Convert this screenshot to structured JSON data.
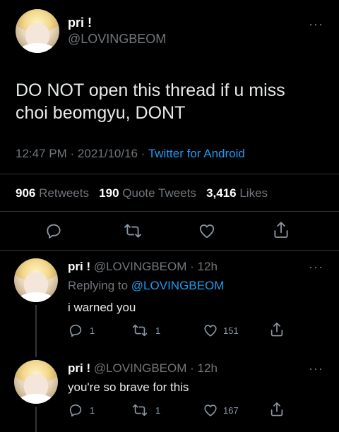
{
  "main_tweet": {
    "display_name": "pri !",
    "handle": "@LOVINGBEOM",
    "text_line1": "DO NOT open this thread if u miss",
    "text_line2": "choi beomgyu, DONT",
    "time": "12:47 PM",
    "dot1": "·",
    "date": "2021/10/16",
    "dot2": "·",
    "source": "Twitter for Android",
    "more": "···",
    "stats": {
      "retweets_count": "906",
      "retweets_label": "Retweets",
      "quote_count": "190",
      "quote_label": "Quote Tweets",
      "likes_count": "3,416",
      "likes_label": "Likes"
    }
  },
  "replies": [
    {
      "display_name": "pri !",
      "handle": "@LOVINGBEOM",
      "dot": "·",
      "age": "12h",
      "replying_prefix": "Replying to",
      "replying_handle": "@LOVINGBEOM",
      "text": "i warned you",
      "reply_count": "1",
      "retweet_count": "1",
      "like_count": "151",
      "more": "···"
    },
    {
      "display_name": "pri !",
      "handle": "@LOVINGBEOM",
      "dot": "·",
      "age": "12h",
      "text": "you're so brave for this",
      "reply_count": "1",
      "retweet_count": "1",
      "like_count": "167",
      "more": "···"
    }
  ],
  "colors": {
    "background": "#000000",
    "text": "#e7e9ea",
    "muted": "#71767b",
    "accent": "#1d9bf0",
    "divider": "#2f3336"
  },
  "icons": [
    "reply-icon",
    "retweet-icon",
    "like-icon",
    "share-icon",
    "more-icon"
  ]
}
